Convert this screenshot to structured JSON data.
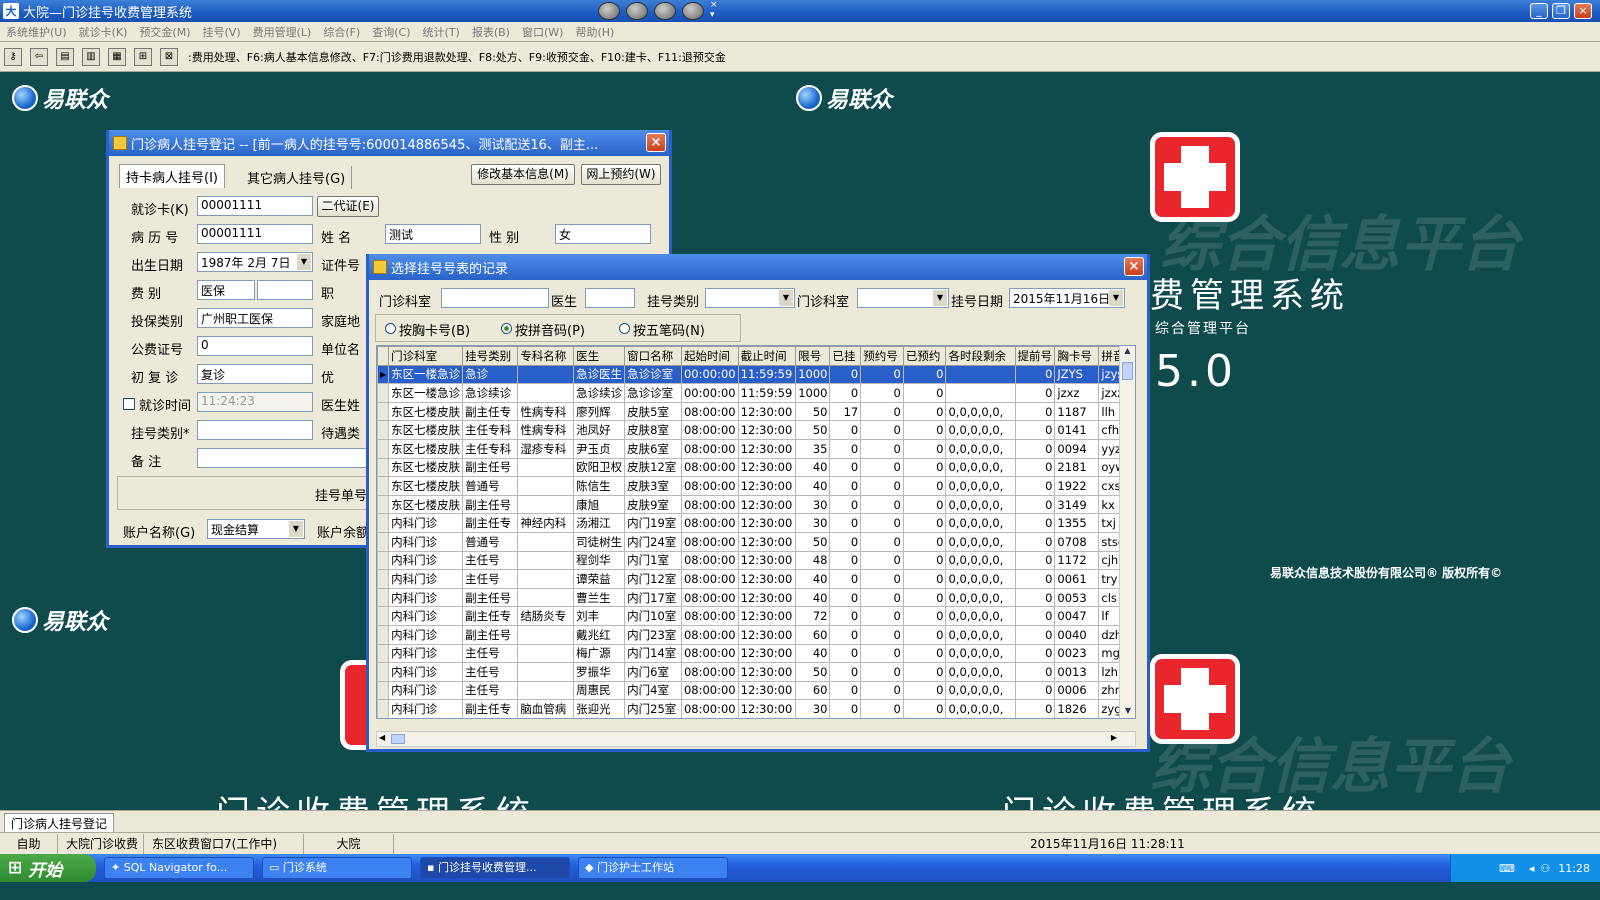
{
  "app": {
    "title": "大院—门诊挂号收费管理系统",
    "menus": [
      "系统维护(U)",
      "就诊卡(K)",
      "预交金(M)",
      "挂号(V)",
      "费用管理(L)",
      "综合(F)",
      "查询(C)",
      "统计(T)",
      "报表(B)",
      "窗口(W)",
      "帮助(H)"
    ],
    "toolbar_hint": ":费用处理、F6:病人基本信息修改、F7:门诊费用退款处理、F8:处方、F9:收预交金、F10:建卡、F11:退预交金"
  },
  "desktop": {
    "logo_text": "易联众",
    "subtitle_left": "门诊收费管理系统",
    "subtitle_right": "门诊收费管理系统",
    "title_right": "费管理系统",
    "platform": "综合管理平台",
    "version": "5.0",
    "copyright": "易联众信息技术股份有限公司® 版权所有©",
    "watermark": "综合信息平台"
  },
  "reg_window": {
    "title": "门诊病人挂号登记 -- [前一病人的挂号号:600014886545、测试配送16、副主...",
    "tabs": [
      "持卡病人挂号(I)",
      "其它病人挂号(G)"
    ],
    "btn_modify": "修改基本信息(M)",
    "btn_online": "网上预约(W)",
    "btn_idcard": "二代证(E)",
    "labels": {
      "card": "就诊卡(K)",
      "record": "病 历 号",
      "name": "姓    名",
      "gender": "性    别",
      "birth": "出生日期",
      "cert": "证件号",
      "fee": "费    别",
      "job": "职",
      "insure": "投保类别",
      "home": "家庭地",
      "pubno": "公费证号",
      "unit": "单位名",
      "revisit": "初 复 诊",
      "prio": "优",
      "time": "就诊时间",
      "doctor": "医生姓",
      "regtype": "挂号类别*",
      "treat": "待遇类",
      "memo": "备    注",
      "single": "挂号单号",
      "account": "账户名称(G)",
      "balance": "账户余额"
    },
    "values": {
      "card": "00001111",
      "record": "00001111",
      "name": "测试",
      "gender": "女",
      "birth": "1987年 2月 7日",
      "fee": "医保",
      "insure": "广州职工医保",
      "pubno": "0",
      "revisit": "复诊",
      "time": "11:24:23",
      "regtype": "",
      "memo": "",
      "account": "现金结算"
    }
  },
  "select_dialog": {
    "title": "选择挂号号表的记录",
    "filter_labels": {
      "dept": "门诊科室",
      "doctor": "医生",
      "type": "挂号类别",
      "dept2": "门诊科室",
      "date": "挂号日期"
    },
    "filter_date": "2015年11月16日",
    "radios": [
      "按胸卡号(B)",
      "按拼音码(P)",
      "按五笔码(N)"
    ],
    "radio_selected": 1,
    "columns": [
      "门诊科室",
      "挂号类别",
      "专科名称",
      "医生",
      "窗口名称",
      "起始时间",
      "截止时间",
      "限号",
      "已挂",
      "预约号",
      "已预约",
      "各时段剩余",
      "提前号",
      "胸卡号",
      "拼音"
    ],
    "rows": [
      [
        "东区一楼急诊",
        "急诊",
        "",
        "急诊医生",
        "急诊诊室",
        "00:00:00",
        "11:59:59",
        "1000",
        "0",
        "0",
        "0",
        "",
        "0",
        "JZYS",
        "jzys"
      ],
      [
        "东区一楼急诊",
        "急诊续诊",
        "",
        "急诊续诊",
        "急诊诊室",
        "00:00:00",
        "11:59:59",
        "1000",
        "0",
        "0",
        "0",
        "",
        "0",
        "jzxz",
        "jzxz"
      ],
      [
        "东区七楼皮肤",
        "副主任专",
        "性病专科",
        "廖列辉",
        "皮肤5室",
        "08:00:00",
        "12:30:00",
        "50",
        "17",
        "0",
        "0",
        "0,0,0,0,0,",
        "0",
        "1187",
        "llh"
      ],
      [
        "东区七楼皮肤",
        "主任专科",
        "性病专科",
        "池凤好",
        "皮肤8室",
        "08:00:00",
        "12:30:00",
        "50",
        "0",
        "0",
        "0",
        "0,0,0,0,0,",
        "0",
        "0141",
        "cfh"
      ],
      [
        "东区七楼皮肤",
        "主任专科",
        "湿疹专科",
        "尹玉贞",
        "皮肤6室",
        "08:00:00",
        "12:30:00",
        "35",
        "0",
        "0",
        "0",
        "0,0,0,0,0,",
        "0",
        "0094",
        "yyz"
      ],
      [
        "东区七楼皮肤",
        "副主任号",
        "",
        "欧阳卫权",
        "皮肤12室",
        "08:00:00",
        "12:30:00",
        "40",
        "0",
        "0",
        "0",
        "0,0,0,0,0,",
        "0",
        "2181",
        "oywq"
      ],
      [
        "东区七楼皮肤",
        "普通号",
        "",
        "陈信生",
        "皮肤3室",
        "08:00:00",
        "12:30:00",
        "40",
        "0",
        "0",
        "0",
        "0,0,0,0,0,",
        "0",
        "1922",
        "cxs"
      ],
      [
        "东区七楼皮肤",
        "副主任号",
        "",
        "康旭",
        "皮肤9室",
        "08:00:00",
        "12:30:00",
        "30",
        "0",
        "0",
        "0",
        "0,0,0,0,0,",
        "0",
        "3149",
        "kx"
      ],
      [
        "内科门诊",
        "副主任专",
        "神经内科",
        "汤湘江",
        "内门19室",
        "08:00:00",
        "12:30:00",
        "30",
        "0",
        "0",
        "0",
        "0,0,0,0,0,",
        "0",
        "1355",
        "txj"
      ],
      [
        "内科门诊",
        "普通号",
        "",
        "司徒树生",
        "内门24室",
        "08:00:00",
        "12:30:00",
        "50",
        "0",
        "0",
        "0",
        "0,0,0,0,0,",
        "0",
        "0708",
        "stsc"
      ],
      [
        "内科门诊",
        "主任号",
        "",
        "程剑华",
        "内门1室",
        "08:00:00",
        "12:30:00",
        "48",
        "0",
        "0",
        "0",
        "0,0,0,0,0,",
        "0",
        "1172",
        "cjh"
      ],
      [
        "内科门诊",
        "主任号",
        "",
        "谭荣益",
        "内门12室",
        "08:00:00",
        "12:30:00",
        "40",
        "0",
        "0",
        "0",
        "0,0,0,0,0,",
        "0",
        "0061",
        "try"
      ],
      [
        "内科门诊",
        "副主任号",
        "",
        "曹兰生",
        "内门17室",
        "08:00:00",
        "12:30:00",
        "40",
        "0",
        "0",
        "0",
        "0,0,0,0,0,",
        "0",
        "0053",
        "cls"
      ],
      [
        "内科门诊",
        "副主任专",
        "结肠炎专",
        "刘丰",
        "内门10室",
        "08:00:00",
        "12:30:00",
        "72",
        "0",
        "0",
        "0",
        "0,0,0,0,0,",
        "0",
        "0047",
        "lf"
      ],
      [
        "内科门诊",
        "副主任号",
        "",
        "戴兆红",
        "内门23室",
        "08:00:00",
        "12:30:00",
        "60",
        "0",
        "0",
        "0",
        "0,0,0,0,0,",
        "0",
        "0040",
        "dzh"
      ],
      [
        "内科门诊",
        "主任号",
        "",
        "梅广源",
        "内门14室",
        "08:00:00",
        "12:30:00",
        "40",
        "0",
        "0",
        "0",
        "0,0,0,0,0,",
        "0",
        "0023",
        "mgy"
      ],
      [
        "内科门诊",
        "主任号",
        "",
        "罗振华",
        "内门6室",
        "08:00:00",
        "12:30:00",
        "50",
        "0",
        "0",
        "0",
        "0,0,0,0,0,",
        "0",
        "0013",
        "lzh"
      ],
      [
        "内科门诊",
        "主任号",
        "",
        "周惠民",
        "内门4室",
        "08:00:00",
        "12:30:00",
        "60",
        "0",
        "0",
        "0",
        "0,0,0,0,0,",
        "0",
        "0006",
        "zhm"
      ],
      [
        "内科门诊",
        "副主任专",
        "脑血管病",
        "张迎光",
        "内门25室",
        "08:00:00",
        "12:30:00",
        "30",
        "0",
        "0",
        "0",
        "0,0,0,0,0,",
        "0",
        "1826",
        "zyg"
      ]
    ]
  },
  "status": {
    "doc_tab": "门诊病人挂号登记",
    "segments": [
      "自助",
      "大院门诊收费",
      "东区收费窗口7(工作中)",
      "大院"
    ],
    "datetime": "2015年11月16日 11:28:11"
  },
  "taskbar": {
    "start": "开始",
    "tasks": [
      "SQL Navigator fo...",
      "门诊系统",
      "门诊挂号收费管理...",
      "门诊护士工作站"
    ],
    "active": 2,
    "clock": "11:28"
  }
}
